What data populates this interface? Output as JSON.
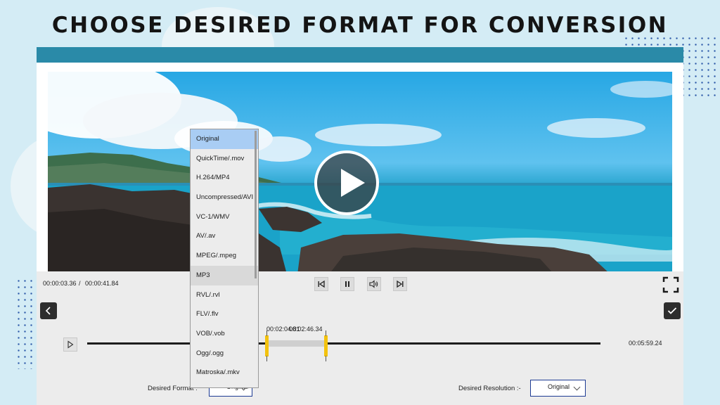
{
  "headline": "CHOOSE DESIRED FORMAT FOR CONVERSION",
  "player": {
    "current_time": "00:00:03.36",
    "time_separator": "/",
    "total_time": "00:00:41.84",
    "trim_start_time": "00:02:04.81",
    "trim_end_time": "00:02:46.34",
    "timeline_end_time": "00:05:59.24"
  },
  "controls": {
    "desired_format_label": "Desired Format :",
    "desired_format_value": "Original",
    "desired_resolution_label": "Desired Resolution :-",
    "desired_resolution_value": "Original"
  },
  "dropdown": {
    "options": [
      "Original",
      "QuickTime/.mov",
      "H.264/MP4",
      "Uncompressed/AVI",
      "VC-1/WMV",
      "AV/.av",
      "MPEG/.mpeg",
      "MP3",
      "RVL/.rvl",
      "FLV/.flv",
      "VOB/.vob",
      "Ogg/.ogg",
      "Matroska/.mkv"
    ],
    "selected": "Original",
    "highlighted": "MP3"
  },
  "colors": {
    "titlebar": "#2a8aa8",
    "trim_marker": "#f3c20e",
    "selection": "#a9cdf4",
    "select_border": "#1d3b94"
  }
}
